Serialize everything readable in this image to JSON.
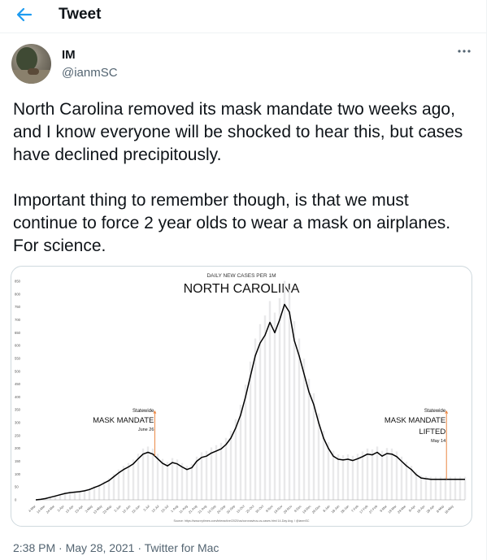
{
  "header": {
    "title": "Tweet",
    "back_icon": "arrow-left-icon",
    "accent": "#1d9bf0"
  },
  "author": {
    "display_name": "IM",
    "handle": "@ianmSC",
    "avatar": "profile-photo"
  },
  "tweet": {
    "paragraphs": [
      "North Carolina removed its mask mandate two weeks ago, and I know everyone will be shocked to hear this, but cases have declined precipitously.",
      "Important thing to remember though, is that we must continue to force 2 year olds to wear a mask on airplanes. For science."
    ]
  },
  "meta": {
    "time": "2:38 PM",
    "separator": "·",
    "date": "May 28, 2021",
    "client": "Twitter for Mac"
  },
  "chart_data": {
    "type": "line",
    "supertitle": "DAILY NEW CASES PER 1M",
    "title": "NORTH CAROLINA",
    "source": "Source: https://www.nytimes.com/interactive/2020/us/coronavirus-us-cases.html 14-Day Avg. / @ianmSC",
    "ylim": [
      0,
      850
    ],
    "yticks": [
      0,
      50,
      100,
      150,
      200,
      250,
      300,
      350,
      400,
      450,
      500,
      550,
      600,
      650,
      700,
      750,
      800,
      850
    ],
    "xticks": [
      "4-Mar",
      "14-Mar",
      "24-Mar",
      "3-Apr",
      "13-Apr",
      "23-Apr",
      "3-May",
      "13-May",
      "23-May",
      "2-Jun",
      "12-Jun",
      "22-Jun",
      "2-Jul",
      "12-Jul",
      "22-Jul",
      "1-Aug",
      "11-Aug",
      "21-Aug",
      "31-Aug",
      "10-Sep",
      "20-Sep",
      "30-Sep",
      "10-Oct",
      "20-Oct",
      "30-Oct",
      "9-Nov",
      "19-Nov",
      "29-Nov",
      "9-Dec",
      "19-Dec",
      "29-Dec",
      "8-Jan",
      "18-Jan",
      "28-Jan",
      "7-Feb",
      "17-Feb",
      "27-Feb",
      "9-Mar",
      "19-Mar",
      "29-Mar",
      "8-Apr",
      "18-Apr",
      "28-Apr",
      "8-May",
      "18-May"
    ],
    "series": [
      {
        "color": "#000000",
        "x": [
          0,
          5,
          10,
          15,
          20,
          25,
          30,
          35,
          40,
          45,
          50,
          55,
          60,
          65,
          70,
          75,
          80,
          85,
          90,
          95,
          100,
          105,
          110,
          115,
          120,
          125,
          130,
          135,
          140,
          145,
          150,
          155,
          160,
          165,
          170,
          175,
          180,
          185,
          190,
          195,
          200,
          205,
          210,
          215,
          220,
          225,
          230,
          235,
          240,
          245,
          250,
          255,
          260,
          265,
          270,
          275,
          280,
          285,
          290,
          295,
          300,
          305,
          310,
          315,
          320,
          325,
          330,
          335,
          340,
          345,
          350,
          355,
          360,
          365,
          370,
          375,
          380,
          385,
          390,
          395,
          400,
          405,
          410,
          415,
          420,
          425,
          430,
          435,
          440
        ],
        "values": [
          0,
          2,
          5,
          10,
          15,
          20,
          25,
          28,
          30,
          32,
          35,
          40,
          48,
          55,
          65,
          75,
          90,
          105,
          118,
          128,
          140,
          160,
          178,
          185,
          178,
          160,
          142,
          132,
          145,
          140,
          128,
          118,
          125,
          150,
          165,
          170,
          182,
          190,
          198,
          215,
          240,
          280,
          330,
          400,
          480,
          560,
          610,
          640,
          690,
          650,
          700,
          760,
          730,
          620,
          560,
          490,
          420,
          370,
          300,
          240,
          200,
          170,
          158,
          155,
          158,
          153,
          160,
          168,
          178,
          175,
          185,
          170,
          180,
          178,
          168,
          150,
          132,
          118,
          98,
          85,
          82,
          80,
          80,
          80,
          80,
          80,
          80,
          80,
          80
        ]
      }
    ],
    "annotations": [
      {
        "x": 122,
        "title": "Statewide",
        "label": "MASK MANDATE",
        "date": "June 26",
        "color": "#e87a2f"
      },
      {
        "x": 421,
        "title": "Statewide",
        "label": "MASK MANDATE",
        "label2": "LIFTED",
        "date": "May 14",
        "color": "#e87a2f"
      }
    ],
    "grid": false
  }
}
